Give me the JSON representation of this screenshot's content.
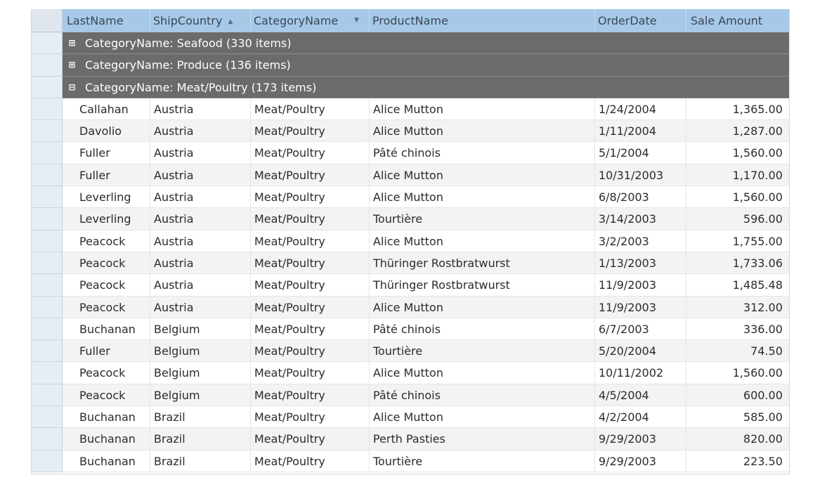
{
  "grid": {
    "columns": [
      {
        "label": "LastName"
      },
      {
        "label": "ShipCountry",
        "sort_glyph": "▲"
      },
      {
        "label": "CategoryName",
        "filter_glyph": "▼"
      },
      {
        "label": "ProductName"
      },
      {
        "label": "OrderDate"
      },
      {
        "label": "Sale Amount"
      }
    ],
    "groups": [
      {
        "label": "CategoryName: Seafood (330 items)",
        "expander": "⊞"
      },
      {
        "label": "CategoryName: Produce (136 items)",
        "expander": "⊞"
      },
      {
        "label": "CategoryName: Meat/Poultry (173 items)",
        "expander": "⊟"
      }
    ],
    "rows": [
      [
        "Callahan",
        "Austria",
        "Meat/Poultry",
        "Alice Mutton",
        "1/24/2004",
        "1,365.00"
      ],
      [
        "Davolio",
        "Austria",
        "Meat/Poultry",
        "Alice Mutton",
        "1/11/2004",
        "1,287.00"
      ],
      [
        "Fuller",
        "Austria",
        "Meat/Poultry",
        "Pâté chinois",
        "5/1/2004",
        "1,560.00"
      ],
      [
        "Fuller",
        "Austria",
        "Meat/Poultry",
        "Alice Mutton",
        "10/31/2003",
        "1,170.00"
      ],
      [
        "Leverling",
        "Austria",
        "Meat/Poultry",
        "Alice Mutton",
        "6/8/2003",
        "1,560.00"
      ],
      [
        "Leverling",
        "Austria",
        "Meat/Poultry",
        "Tourtière",
        "3/14/2003",
        "596.00"
      ],
      [
        "Peacock",
        "Austria",
        "Meat/Poultry",
        "Alice Mutton",
        "3/2/2003",
        "1,755.00"
      ],
      [
        "Peacock",
        "Austria",
        "Meat/Poultry",
        "Thüringer Rostbratwurst",
        "1/13/2003",
        "1,733.06"
      ],
      [
        "Peacock",
        "Austria",
        "Meat/Poultry",
        "Thüringer Rostbratwurst",
        "11/9/2003",
        "1,485.48"
      ],
      [
        "Peacock",
        "Austria",
        "Meat/Poultry",
        "Alice Mutton",
        "11/9/2003",
        "312.00"
      ],
      [
        "Buchanan",
        "Belgium",
        "Meat/Poultry",
        "Pâté chinois",
        "6/7/2003",
        "336.00"
      ],
      [
        "Fuller",
        "Belgium",
        "Meat/Poultry",
        "Tourtière",
        "5/20/2004",
        "74.50"
      ],
      [
        "Peacock",
        "Belgium",
        "Meat/Poultry",
        "Alice Mutton",
        "10/11/2002",
        "1,560.00"
      ],
      [
        "Peacock",
        "Belgium",
        "Meat/Poultry",
        "Pâté chinois",
        "4/5/2004",
        "600.00"
      ],
      [
        "Buchanan",
        "Brazil",
        "Meat/Poultry",
        "Alice Mutton",
        "4/2/2004",
        "585.00"
      ],
      [
        "Buchanan",
        "Brazil",
        "Meat/Poultry",
        "Perth Pasties",
        "9/29/2003",
        "820.00"
      ],
      [
        "Buchanan",
        "Brazil",
        "Meat/Poultry",
        "Tourtière",
        "9/29/2003",
        "223.50"
      ]
    ]
  },
  "colors": {
    "header_bg": "#a6c9e8",
    "group_bg": "#6b6b6b",
    "alt_row_bg": "#f3f3f3"
  }
}
